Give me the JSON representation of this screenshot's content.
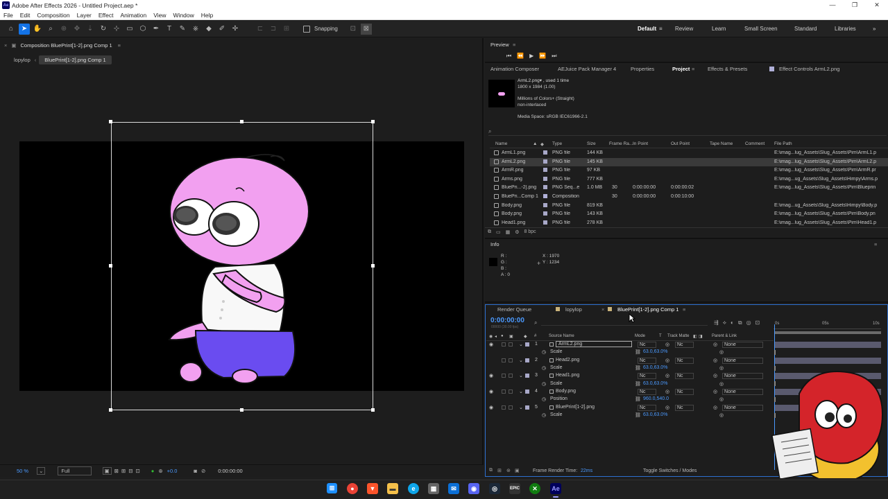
{
  "app": {
    "title": "Adobe After Effects 2026 - Untitled Project.aep *",
    "logo_text": "Ae",
    "window_controls": [
      "—",
      "❐",
      "✕"
    ]
  },
  "menu": [
    "File",
    "Edit",
    "Composition",
    "Layer",
    "Effect",
    "Animation",
    "View",
    "Window",
    "Help"
  ],
  "toolbar": {
    "snapping_label": "Snapping",
    "workspaces": [
      "Default",
      "Review",
      "Learn",
      "Small Screen",
      "Standard",
      "Libraries"
    ],
    "active_workspace": "Default"
  },
  "composition_panel": {
    "title": "Composition BluePrint[1-2].png Comp 1",
    "breadcrumbs": [
      "lopylop",
      "BluePrint[1-2].png Comp 1"
    ],
    "zoom": "50 %",
    "resolution": "Full",
    "exposure": "+0.0",
    "timecode": "0:00:00:00"
  },
  "preview": {
    "title": "Preview"
  },
  "project_tabs": {
    "tabs": [
      "Animation Composer",
      "AEJuice Pack Manager 4",
      "Properties",
      "Project",
      "Effects & Presets",
      "Effect Controls ArmL2.png"
    ],
    "active": "Project"
  },
  "project_info": {
    "name": "ArmL2.png▾ , used 1 time",
    "dimensions": "1800 x 1984 (1.00)",
    "colors": "Millions of Colors+ (Straight)",
    "interlace": "non-interlaced",
    "media_space": "Media Space: sRGB IEC61966-2.1"
  },
  "project_columns": [
    "Name",
    "Type",
    "Size",
    "Frame Ra...",
    "In Point",
    "Out Point",
    "Tape Name",
    "Comment",
    "File Path"
  ],
  "project_items": [
    {
      "name": "ArmL1.png",
      "type": "PNG file",
      "size": "144 KB",
      "fps": "",
      "in": "",
      "out": "",
      "path": "E:\\imag...lug_Assets\\Slug_Assets\\Pim\\ArmL1.p",
      "selected": false
    },
    {
      "name": "ArmL2.png",
      "type": "PNG file",
      "size": "145 KB",
      "fps": "",
      "in": "",
      "out": "",
      "path": "E:\\imag...lug_Assets\\Slug_Assets\\Pim\\ArmL2.p",
      "selected": true
    },
    {
      "name": "ArmR.png",
      "type": "PNG file",
      "size": "97 KB",
      "fps": "",
      "in": "",
      "out": "",
      "path": "E:\\imag...lug_Assets\\Slug_Assets\\Pim\\ArmR.pr",
      "selected": false
    },
    {
      "name": "Arms.png",
      "type": "PNG file",
      "size": "777 KB",
      "fps": "",
      "in": "",
      "out": "",
      "path": "E:\\imag...ug_Assets\\Slug_Assets\\Himpy\\Arms.p",
      "selected": false
    },
    {
      "name": "BluePri...-2].png",
      "type": "PNG Seq...e",
      "size": "1.0 MB",
      "fps": "30",
      "in": "0:00:00:00",
      "out": "0:00:00:02",
      "path": "E:\\imag...lug_Assets\\Slug_Assets\\Pim\\Blueprin",
      "selected": false
    },
    {
      "name": "BluePri...Comp 1",
      "type": "Composition",
      "size": "",
      "fps": "30",
      "in": "0:00:00:00",
      "out": "0:00:10:00",
      "path": "",
      "selected": false
    },
    {
      "name": "Body.png",
      "type": "PNG file",
      "size": "819 KB",
      "fps": "",
      "in": "",
      "out": "",
      "path": "E:\\imag...ug_Assets\\Slug_Assets\\Himpy\\Body.p",
      "selected": false
    },
    {
      "name": "Body.png",
      "type": "PNG file",
      "size": "143 KB",
      "fps": "",
      "in": "",
      "out": "",
      "path": "E:\\imag...lug_Assets\\Slug_Assets\\Pim\\Body.pn",
      "selected": false
    },
    {
      "name": "Head1.png",
      "type": "PNG file",
      "size": "278 KB",
      "fps": "",
      "in": "",
      "out": "",
      "path": "E:\\imag...lug_Assets\\Slug_Assets\\Pim\\Head1.p",
      "selected": false
    }
  ],
  "project_footer": {
    "bpc": "8 bpc"
  },
  "info_panel": {
    "title": "Info",
    "r": "R :",
    "g": "G :",
    "b": "B :",
    "a": "A : 0",
    "x": "X : 1970",
    "y": "Y : 1234"
  },
  "timeline": {
    "tabs": [
      "Render Queue",
      "lopylop",
      "BluePrint[1-2].png Comp 1"
    ],
    "timecode": "0:00:00:00",
    "fps_sub": "00000 (30.00 fps)",
    "columns": [
      "#",
      "Source Name",
      "Mode",
      "T",
      "Track Matte",
      "Parent & Link"
    ],
    "ruler": [
      "0s",
      "05s",
      "10s"
    ],
    "layers": [
      {
        "num": "1",
        "name": "ArmL2.png",
        "mode": "Nc",
        "matte": "Nc",
        "parent": "None",
        "prop": "Scale",
        "value": "63.0,63.0%"
      },
      {
        "num": "2",
        "name": "Head2.png",
        "mode": "Nc",
        "matte": "Nc",
        "parent": "None",
        "prop": "Scale",
        "value": "63.0,63.0%"
      },
      {
        "num": "3",
        "name": "Head1.png",
        "mode": "Nc",
        "matte": "Nc",
        "parent": "None",
        "prop": "Scale",
        "value": "63.0,63.0%"
      },
      {
        "num": "4",
        "name": "Body.png",
        "mode": "Nc",
        "matte": "Nc",
        "parent": "None",
        "prop": "Position",
        "value": "960.0,540.0"
      },
      {
        "num": "5",
        "name": "BluePrint[1-2].png",
        "mode": "Nc",
        "matte": "Nc",
        "parent": "None",
        "prop": "Scale",
        "value": "63.0,63.0%"
      }
    ],
    "footer_render": "Frame Render Time:",
    "footer_render_value": "22ms",
    "footer_toggle": "Toggle Switches / Modes"
  },
  "colors": {
    "accent": "#1473e6",
    "value_blue": "#4b9aff",
    "character_pink": "#f2a0f0",
    "character_blue": "#6a4cf0"
  }
}
